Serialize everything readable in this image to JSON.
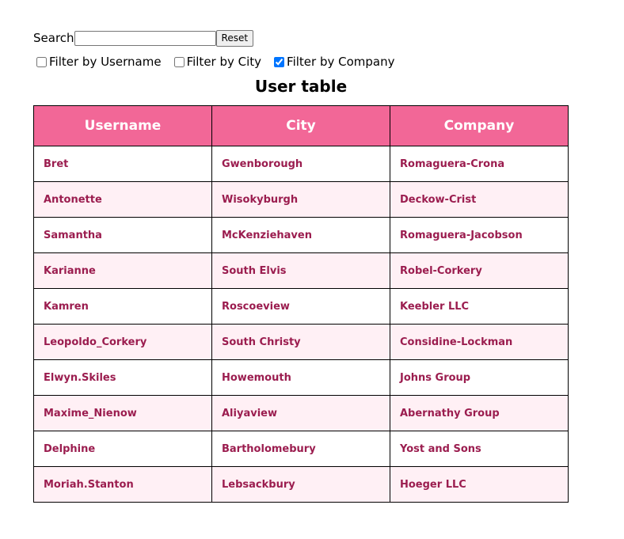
{
  "search": {
    "label": "Search",
    "value": "",
    "reset_label": "Reset"
  },
  "filters": [
    {
      "label": "Filter by Username",
      "checked": false
    },
    {
      "label": "Filter by City",
      "checked": false
    },
    {
      "label": "Filter by Company",
      "checked": true
    }
  ],
  "table": {
    "title": "User table",
    "columns": [
      "Username",
      "City",
      "Company"
    ],
    "rows": [
      [
        "Bret",
        "Gwenborough",
        "Romaguera-Crona"
      ],
      [
        "Antonette",
        "Wisokyburgh",
        "Deckow-Crist"
      ],
      [
        "Samantha",
        "McKenziehaven",
        "Romaguera-Jacobson"
      ],
      [
        "Karianne",
        "South Elvis",
        "Robel-Corkery"
      ],
      [
        "Kamren",
        "Roscoeview",
        "Keebler LLC"
      ],
      [
        "Leopoldo_Corkery",
        "South Christy",
        "Considine-Lockman"
      ],
      [
        "Elwyn.Skiles",
        "Howemouth",
        "Johns Group"
      ],
      [
        "Maxime_Nienow",
        "Aliyaview",
        "Abernathy Group"
      ],
      [
        "Delphine",
        "Bartholomebury",
        "Yost and Sons"
      ],
      [
        "Moriah.Stanton",
        "Lebsackbury",
        "Hoeger LLC"
      ]
    ]
  },
  "colors": {
    "header_bg": "#f26797",
    "header_text": "#ffffff",
    "cell_text": "#9b1d4f",
    "alt_row_bg": "#fff0f5"
  }
}
